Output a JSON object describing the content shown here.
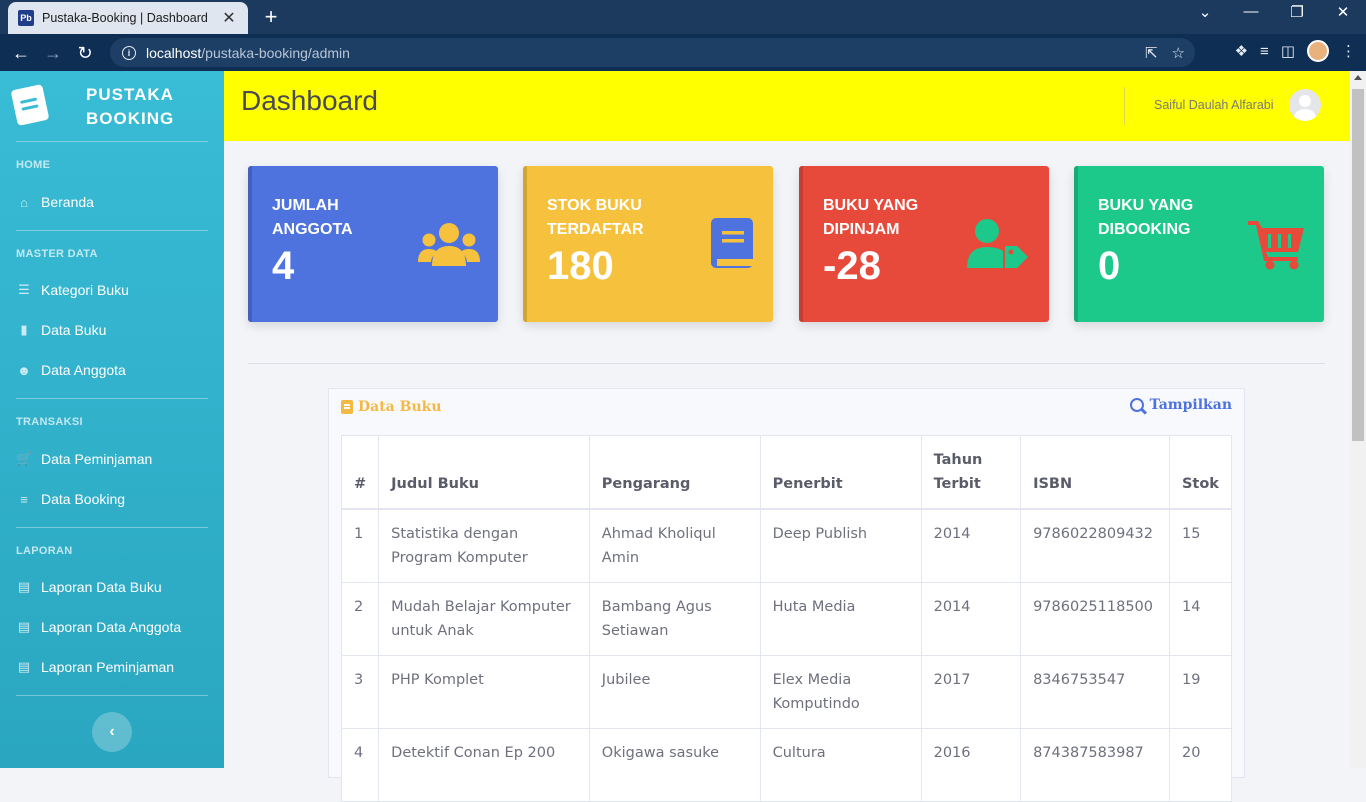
{
  "browser": {
    "tab_title": "Pustaka-Booking | Dashboard",
    "tab_favicon": "Pb",
    "tab_close": "✕",
    "new_tab": "+",
    "url_host": "localhost",
    "url_path": "/pustaka-booking/admin",
    "controls": {
      "minimize": "—",
      "maximize": "❐",
      "close": "✕",
      "dropdown": "⌄"
    }
  },
  "sidebar": {
    "brand_line1": "PUSTAKA",
    "brand_line2": "BOOKING",
    "sections": [
      {
        "heading": "HOME",
        "items": [
          {
            "label": "Beranda",
            "icon": "home-icon"
          }
        ]
      },
      {
        "heading": "MASTER DATA",
        "items": [
          {
            "label": "Kategori Buku",
            "icon": "layers-icon"
          },
          {
            "label": "Data Buku",
            "icon": "book-icon"
          },
          {
            "label": "Data Anggota",
            "icon": "users-icon"
          }
        ]
      },
      {
        "heading": "TRANSAKSI",
        "items": [
          {
            "label": "Data Peminjaman",
            "icon": "cart-icon"
          },
          {
            "label": "Data Booking",
            "icon": "list-icon"
          }
        ]
      },
      {
        "heading": "LAPORAN",
        "items": [
          {
            "label": "Laporan Data Buku",
            "icon": "address-book-icon"
          },
          {
            "label": "Laporan Data Anggota",
            "icon": "address-book-icon"
          },
          {
            "label": "Laporan Peminjaman",
            "icon": "address-book-icon"
          }
        ]
      }
    ],
    "collapse_icon": "‹"
  },
  "topbar": {
    "title": "Dashboard",
    "user_name": "Saiful Daulah Alfarabi"
  },
  "cards": [
    {
      "label_line1": "JUMLAH",
      "label_line2": "ANGGOTA",
      "value": "4",
      "color": "#4e73df",
      "icon": "users-icon",
      "icon_color": "#f6c23e"
    },
    {
      "label_line1": "STOK BUKU",
      "label_line2": "TERDAFTAR",
      "value": "180",
      "color": "#f6c23e",
      "icon": "book-icon",
      "icon_color": "#4e73df"
    },
    {
      "label_line1": "BUKU YANG",
      "label_line2": "DIPINJAM",
      "value": "-28",
      "color": "#e74a3b",
      "icon": "user-tag-icon",
      "icon_color": "#1cc88a"
    },
    {
      "label_line1": "BUKU YANG",
      "label_line2": "DIBOOKING",
      "value": "0",
      "color": "#1cc88a",
      "icon": "cart-icon",
      "icon_color": "#e74a3b"
    }
  ],
  "books_panel": {
    "title": "Data Buku",
    "action_label": "Tampilkan",
    "columns": [
      "#",
      "Judul Buku",
      "Pengarang",
      "Penerbit",
      "Tahun Terbit",
      "ISBN",
      "Stok"
    ],
    "rows": [
      [
        "1",
        "Statistika dengan Program Komputer",
        "Ahmad Kholiqul Amin",
        "Deep Publish",
        "2014",
        "9786022809432",
        "15"
      ],
      [
        "2",
        "Mudah Belajar Komputer untuk Anak",
        "Bambang Agus Setiawan",
        "Huta Media",
        "2014",
        "9786025118500",
        "14"
      ],
      [
        "3",
        "PHP Komplet",
        "Jubilee",
        "Elex Media Komputindo",
        "2017",
        "8346753547",
        "19"
      ],
      [
        "4",
        "Detektif Conan Ep 200",
        "Okigawa sasuke",
        "Cultura",
        "2016",
        "874387583987",
        "20"
      ]
    ]
  }
}
